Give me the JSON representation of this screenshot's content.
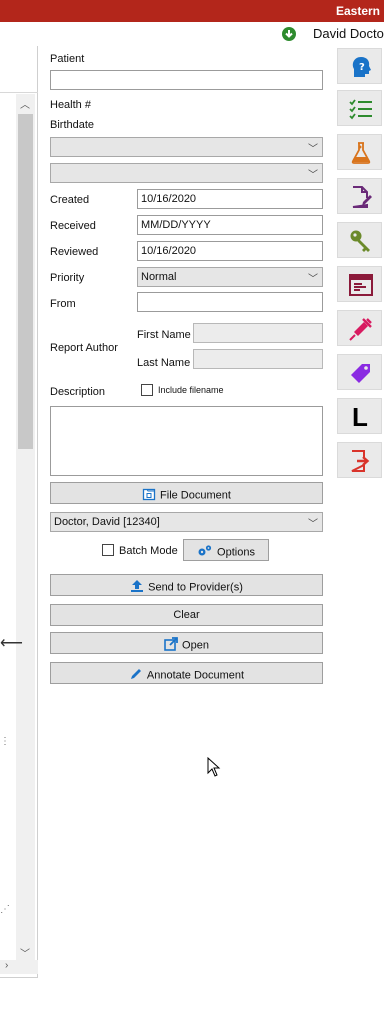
{
  "header": {
    "title": "Eastern"
  },
  "user": {
    "name": "David Doctor"
  },
  "form": {
    "patient_label": "Patient",
    "patient_value": "",
    "health_label": "Health #",
    "birthdate_label": "Birthdate",
    "select1_value": "",
    "select2_value": "",
    "created_label": "Created",
    "created_value": "10/16/2020",
    "received_label": "Received",
    "received_placeholder": "MM/DD/YYYY",
    "reviewed_label": "Reviewed",
    "reviewed_value": "10/16/2020",
    "priority_label": "Priority",
    "priority_value": "Normal",
    "from_label": "From",
    "from_value": "",
    "author_label": "Report Author",
    "first_name_label": "First Name",
    "last_name_label": "Last Name",
    "description_label": "Description",
    "include_filename_label": "Include filename",
    "file_document_label": "File Document",
    "provider_value": "Doctor, David [12340]",
    "batch_mode_label": "Batch Mode",
    "options_label": "Options",
    "send_label": "Send to Provider(s)",
    "clear_label": "Clear",
    "open_label": "Open",
    "annotate_label": "Annotate Document"
  },
  "sidebar": {
    "items": [
      "help-icon",
      "checklist-icon",
      "flask-icon",
      "edit-document-icon",
      "key-icon",
      "form-icon",
      "syringe-icon",
      "tag-icon",
      "l-icon",
      "exit-icon"
    ],
    "letter": "L"
  },
  "colors": {
    "topbar": "#b3261b",
    "accent_blue": "#1a73c8",
    "accent_green": "#2e8b2e",
    "accent_orange": "#d9741c",
    "accent_purple": "#6a2a78",
    "accent_pink": "#d81b60",
    "accent_red": "#d9342b"
  }
}
